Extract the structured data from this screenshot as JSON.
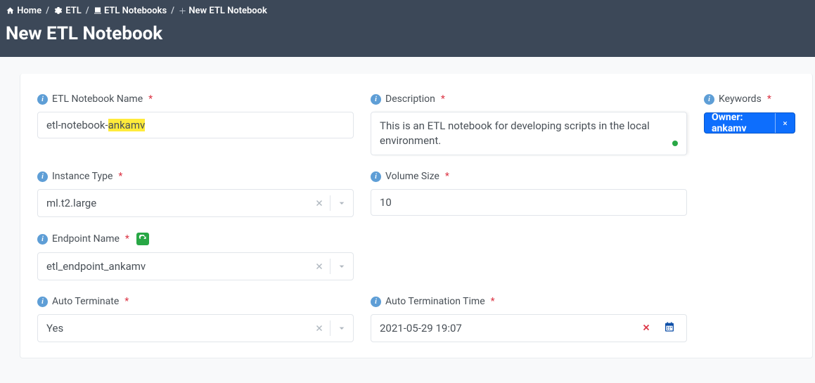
{
  "breadcrumb": {
    "home": "Home",
    "etl": "ETL",
    "notebooks": "ETL Notebooks",
    "current": "New ETL Notebook"
  },
  "page_title": "New ETL Notebook",
  "labels": {
    "name": "ETL Notebook Name",
    "description": "Description",
    "keywords": "Keywords",
    "instance_type": "Instance Type",
    "volume_size": "Volume Size",
    "endpoint_name": "Endpoint Name",
    "auto_terminate": "Auto Terminate",
    "auto_termination_time": "Auto Termination Time"
  },
  "values": {
    "name_prefix": "etl-notebook-",
    "name_hl": "ankamv",
    "description": "This is an ETL notebook for developing scripts in the local environment.",
    "keyword_tag": "Owner: ankamv",
    "instance_type": "ml.t2.large",
    "volume_size": "10",
    "endpoint_name": "etl_endpoint_ankamv",
    "auto_terminate": "Yes",
    "auto_termination_time": "2021-05-29 19:07"
  }
}
